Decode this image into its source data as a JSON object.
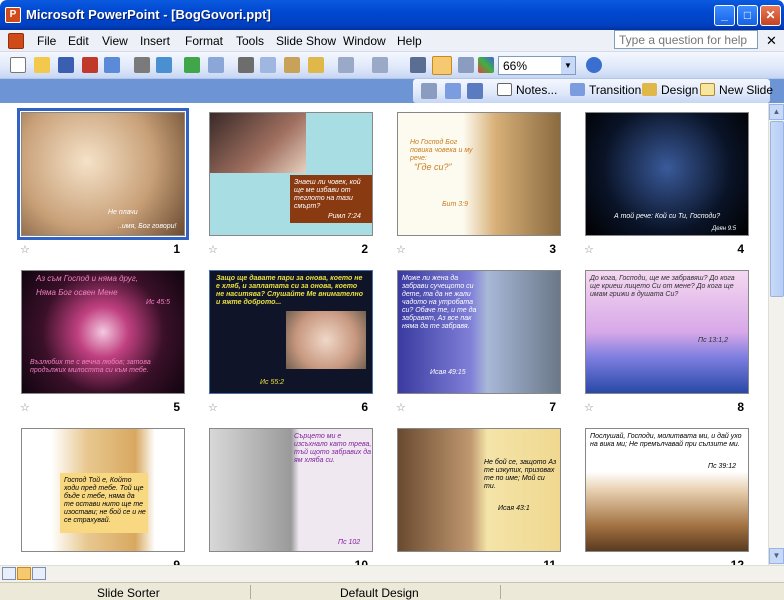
{
  "window": {
    "title": "Microsoft PowerPoint - [BogGovori.ppt]",
    "minimize": "_",
    "maximize": "□",
    "close": "✕"
  },
  "menu": {
    "items": [
      "File",
      "Edit",
      "View",
      "Insert",
      "Format",
      "Tools",
      "Slide Show",
      "Window",
      "Help"
    ],
    "help_placeholder": "Type a question for help",
    "close": "✕"
  },
  "toolbar": {
    "zoom": "66%",
    "zoom_arrow": "▼",
    "notes": "Notes...",
    "transition": "Transition",
    "design": "Design",
    "new_slide": "New Slide"
  },
  "slides": [
    {
      "number": "1",
      "text_a": "Не плачи",
      "text_b": "..имя, Бог говори!"
    },
    {
      "number": "2",
      "text_a": "Знаеш ли човек, кой ще ме избави от теглото на тази смърт?",
      "text_b": "Римл 7:24"
    },
    {
      "number": "3",
      "text_a": "Но Господ Бог повика човека и му рече:",
      "text_b": "“Где си?”",
      "text_c": "Бит 3:9"
    },
    {
      "number": "4",
      "text_a": "А той рече: Кой си Ти, Господи?",
      "text_b": "Деян 9:5"
    },
    {
      "number": "5",
      "text_a": "Аз съм Господ и няма друг,",
      "text_b": "Няма Бог освен Мене",
      "text_c": "Ис 45:5",
      "text_d": "Възлюбих те с вечна любов; затова продължих милостта си към тебе."
    },
    {
      "number": "6",
      "text_a": "Защо ще давате пари за онова, което не е хляб, и заплатата си за онова, което не наситява? Слушайте Ме внимателно и яжте доброто...",
      "text_b": "Ис 55:2"
    },
    {
      "number": "7",
      "text_a": "Може ли жена да забрави сучещото си дете, та да не жали чадото на утробата си? Обаче те, и те да забравят, Аз все пак няма да те забравя.",
      "text_b": "Исая 49:15"
    },
    {
      "number": "8",
      "text_a": "До кога, Господи, ще ме забравяш? До кога ще криеш лицето Си от мене? До кога ще имам грижи в душата Си?",
      "text_b": "Пс 13:1,2"
    },
    {
      "number": "9",
      "text_a": "Господ Той е, Който ходи пред тебе. Той ще бъде с тебе, няма да те остави нито ще те изостави; не бой се и не се страхувай."
    },
    {
      "number": "10",
      "text_a": "Сърцето ми е изсъхнало като трева, тъй щото забравих да ям хляба си.",
      "text_b": "Пс 102"
    },
    {
      "number": "11",
      "text_a": "Не бой се, защото Аз те изкупих, призовах те по име; Мой си ти.",
      "text_b": "Исая 43:1"
    },
    {
      "number": "12",
      "text_a": "Послушай, Господи, молитвата ми, и дай ухо на вика ми; Не премълчавай при сълзите ми.",
      "text_b": "Пс 39:12"
    }
  ],
  "status": {
    "view": "Slide Sorter",
    "design": "Default Design"
  }
}
